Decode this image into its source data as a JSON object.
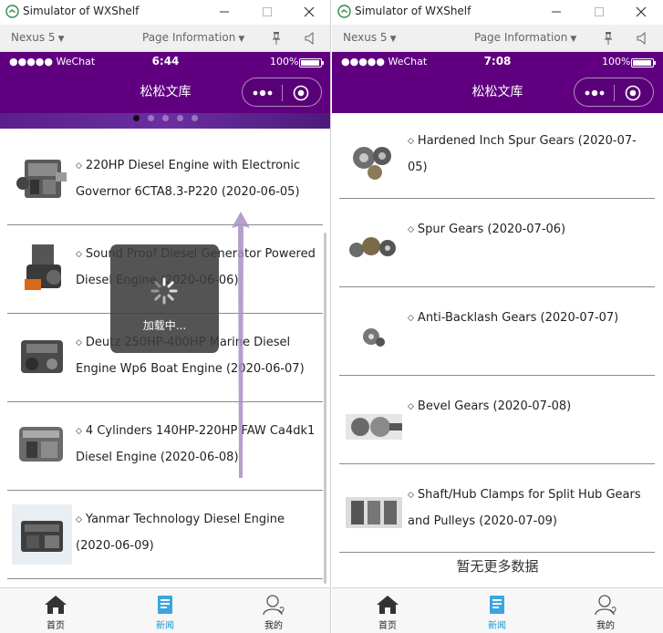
{
  "window": {
    "title": "Simulator of WXShelf"
  },
  "toolbar": {
    "device": "Nexus 5",
    "page_info": "Page Information"
  },
  "left": {
    "status": {
      "carrier": "●●●●● WeChat",
      "time": "6:44",
      "battery": "100%"
    },
    "nav_title": "松松文库",
    "carousel_dots": 5,
    "carousel_active": 0,
    "items": [
      {
        "title": "220HP Diesel Engine with Electronic Governor 6CTA8.3-P220 (2020-06-05)"
      },
      {
        "title": "Sound Proof Diesel Generator Powered Diesel Engine (2020-06-06)"
      },
      {
        "title": "Deutz 250HP-400HP Marine Diesel Engine Wp6 Boat Engine (2020-06-07)"
      },
      {
        "title": "4 Cylinders 140HP-220HP FAW Ca4dk1 Diesel Engine (2020-06-08)"
      },
      {
        "title": "Yanmar Technology Diesel Engine (2020-06-09)"
      }
    ],
    "loading_text": "加载中..."
  },
  "right": {
    "status": {
      "carrier": "●●●●● WeChat",
      "time": "7:08",
      "battery": "100%"
    },
    "nav_title": "松松文库",
    "items": [
      {
        "title": "Hardened Inch Spur Gears (2020-07-05)"
      },
      {
        "title": "Spur Gears (2020-07-06)"
      },
      {
        "title": "Anti-Backlash Gears (2020-07-07)"
      },
      {
        "title": "Bevel Gears (2020-07-08)"
      },
      {
        "title": "Shaft/Hub Clamps for Split Hub Gears and Pulleys (2020-07-09)"
      }
    ],
    "no_more": "暂无更多数据"
  },
  "tabs": {
    "home": "首页",
    "news": "新闻",
    "mine": "我的"
  },
  "colors": {
    "brand": "#600080",
    "tab_active": "#1a9ad6"
  }
}
